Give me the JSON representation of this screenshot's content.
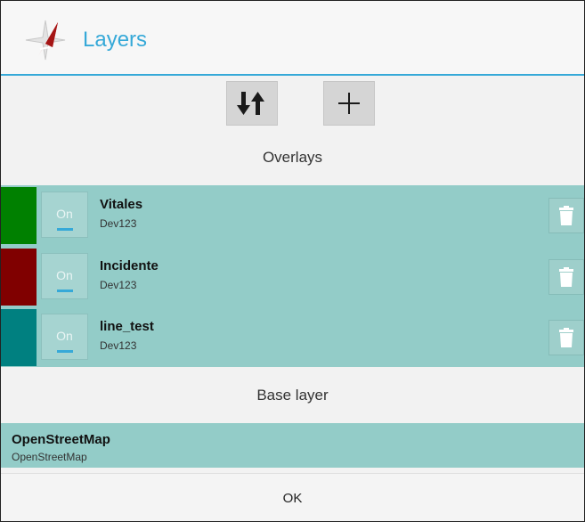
{
  "header": {
    "title": "Layers",
    "icon": "compass-app-icon",
    "accent_color": "#36a9d8"
  },
  "toolbar": {
    "sort_icon": "sort-arrows-icon",
    "add_icon": "plus-icon"
  },
  "overlays": {
    "title": "Overlays",
    "items": [
      {
        "name": "Vitales",
        "owner": "Dev123",
        "color": "#008000",
        "toggle_label": "On"
      },
      {
        "name": "Incidente",
        "owner": "Dev123",
        "color": "#800000",
        "toggle_label": "On"
      },
      {
        "name": "line_test",
        "owner": "Dev123",
        "color": "#008080",
        "toggle_label": "On"
      }
    ]
  },
  "base_layer": {
    "title": "Base layer",
    "name": "OpenStreetMap",
    "subtitle": "OpenStreetMap"
  },
  "footer": {
    "ok_label": "OK"
  }
}
